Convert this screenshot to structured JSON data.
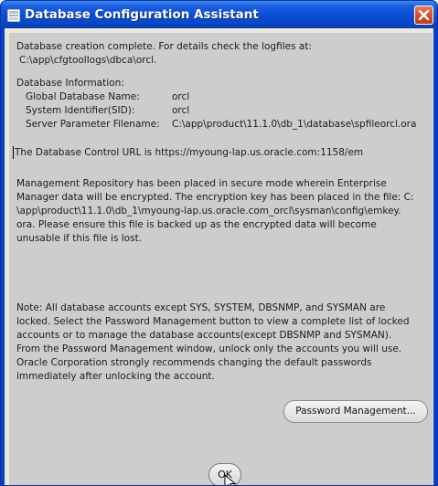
{
  "window": {
    "title": "Database Configuration Assistant",
    "icons": {
      "app": "oracle-app-icon",
      "close": "close-icon"
    }
  },
  "message": {
    "line1": "Database creation complete. For details check the logfiles at:",
    "logfile_path": "C:\\app\\cfgtoollogs\\dbca\\orcl.",
    "info_heading": "Database Information:",
    "info": [
      {
        "label": "Global Database Name:",
        "value": "orcl"
      },
      {
        "label": "System Identifier(SID):",
        "value": "orcl"
      },
      {
        "label": "Server Parameter Filename:",
        "value": "C:\\app\\product\\11.1.0\\db_1\\database\\spfileorcl.ora"
      }
    ],
    "control_url_line": "The Database Control URL is https://myoung-lap.us.oracle.com:1158/em",
    "repository_note_lines": [
      "Management Repository has been placed in secure mode wherein Enterprise",
      "Manager data will be encrypted.  The encryption key has been placed in the file: C:",
      "\\app\\product\\11.1.0\\db_1\\myoung-lap.us.oracle.com_orcl\\sysman\\config\\emkey.",
      "ora.   Please ensure this file is backed up as the encrypted data will become",
      "unusable if this file is lost."
    ],
    "accounts_note_lines": [
      "Note: All database accounts except SYS, SYSTEM, DBSNMP, and SYSMAN are",
      "locked. Select the Password Management button to view a complete list of locked",
      "accounts or to manage the database accounts(except DBSNMP and SYSMAN).",
      "From the Password Management window, unlock only the accounts you will use.",
      "Oracle Corporation strongly recommends changing the default passwords",
      "immediately after unlocking the account."
    ]
  },
  "buttons": {
    "password_management": "Password Management...",
    "ok": "OK"
  },
  "colors": {
    "titlebar": "#0a4fd8",
    "close_button": "#d14b25",
    "panel": "#cdcdcd"
  }
}
